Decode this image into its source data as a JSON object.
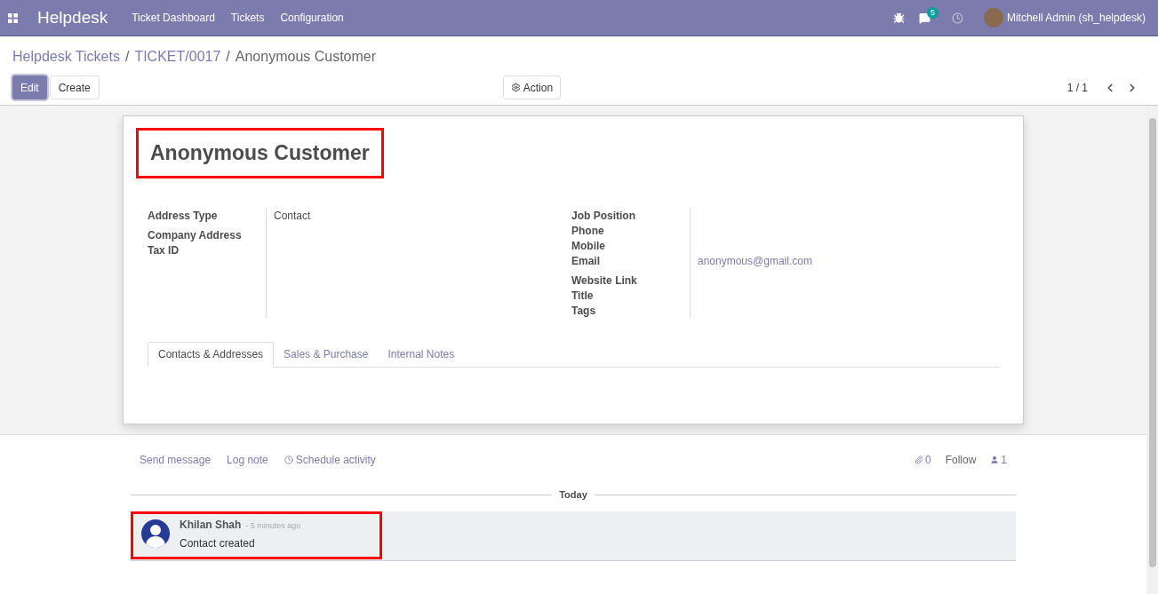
{
  "navbar": {
    "app": "Helpdesk",
    "menu": [
      "Ticket Dashboard",
      "Tickets",
      "Configuration"
    ],
    "messages_count": "5",
    "user": "Mitchell Admin (sh_helpdesk)"
  },
  "breadcrumb_separator": "/",
  "breadcrumbs": [
    {
      "label": "Helpdesk Tickets",
      "kind": "link"
    },
    {
      "label": "TICKET/0017",
      "kind": "link"
    },
    {
      "label": "Anonymous Customer",
      "kind": "current"
    }
  ],
  "buttons": {
    "edit": "Edit",
    "create": "Create",
    "action": "Action"
  },
  "pager": "1 / 1",
  "record": {
    "name": "Anonymous Customer",
    "highlighted": true,
    "left_fields": [
      {
        "label": "Address Type",
        "value": "Contact"
      },
      {
        "label": "Company Address"
      },
      {
        "label": "Tax ID"
      }
    ],
    "right_fields": [
      {
        "label": "Job Position"
      },
      {
        "label": "Phone"
      },
      {
        "label": "Mobile"
      },
      {
        "label": "Email",
        "value": "anonymous@gmail.com",
        "kind": "link"
      },
      {
        "label": "Website Link"
      },
      {
        "label": "Title"
      },
      {
        "label": "Tags"
      }
    ],
    "tabs": [
      {
        "label": "Contacts & Addresses",
        "selected": true
      },
      {
        "label": "Sales & Purchase",
        "selected": false
      },
      {
        "label": "Internal Notes",
        "selected": false
      }
    ]
  },
  "chatter": {
    "actions": [
      "Send message",
      "Log note",
      "Schedule activity"
    ],
    "attachments": "0",
    "follow": "Follow",
    "followers": "1",
    "separator": "Today",
    "messages": [
      {
        "author": "Khilan Shah",
        "time": "- 5 minutes ago",
        "body": "Contact created",
        "highlighted": true
      }
    ]
  }
}
